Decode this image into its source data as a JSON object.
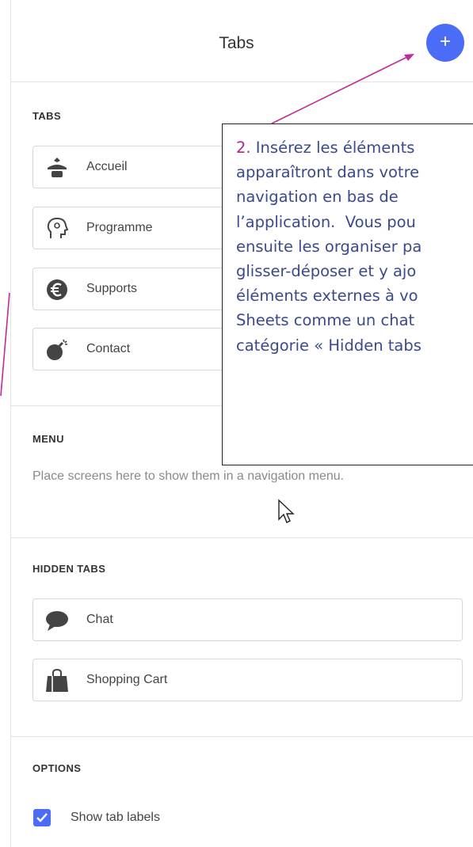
{
  "header": {
    "title": "Tabs",
    "add_button": "+"
  },
  "sections": {
    "tabs": {
      "heading": "TABS",
      "items": [
        {
          "label": "Accueil",
          "icon": "tie-icon"
        },
        {
          "label": "Programme",
          "icon": "head-icon"
        },
        {
          "label": "Supports",
          "icon": "euro-icon"
        },
        {
          "label": "Contact",
          "icon": "bomb-icon"
        }
      ]
    },
    "menu": {
      "heading": "MENU",
      "placeholder": "Place screens here to show them in a navigation menu."
    },
    "hidden_tabs": {
      "heading": "HIDDEN TABS",
      "items": [
        {
          "label": "Chat",
          "icon": "chat-bubble-icon"
        },
        {
          "label": "Shopping Cart",
          "icon": "shopping-bag-icon"
        }
      ]
    },
    "options": {
      "heading": "OPTIONS",
      "show_tab_labels": {
        "label": "Show tab labels",
        "checked": true
      }
    }
  },
  "callout": {
    "number": "2.",
    "lines": [
      " Insérez les éléments",
      "apparaîtront dans votre",
      "navigation en bas de",
      "l’application.  Vous pou",
      "ensuite les organiser pa",
      "glisser-déposer et y ajo",
      "éléments externes à vo",
      "Sheets comme un chat",
      "catégorie « Hidden tabs"
    ]
  },
  "colors": {
    "accent": "#4a6cf7",
    "annotation_arrow": "#c02a9a",
    "callout_text": "#3a4a8c",
    "callout_number": "#b0278c"
  }
}
